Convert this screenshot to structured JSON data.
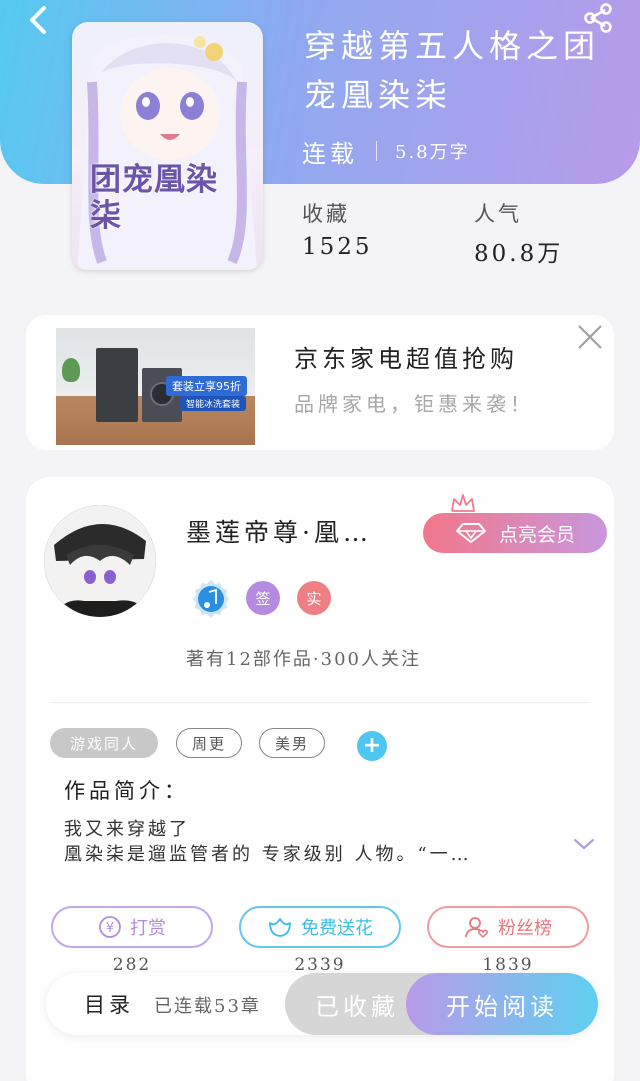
{
  "colors": {
    "hero_start": "#55c9f0",
    "hero_end": "#b79be9",
    "accent_blue": "#4fc6ef",
    "vip_pink": "#f2778a",
    "reward_purple": "#b48be0",
    "flower_blue": "#3cbde8",
    "fans_red": "#e7767d"
  },
  "header": {
    "back_icon": "chevron-left-icon",
    "share_icon": "share-icon"
  },
  "book": {
    "title": "穿越第五人格之团宠凰染柒",
    "status": "连载",
    "word_count": "5.8万字",
    "cover_text": "团宠凰染柒",
    "stats": [
      {
        "label": "收藏",
        "value": "1525"
      },
      {
        "label": "人气",
        "value": "80.8万"
      }
    ]
  },
  "ad": {
    "title": "京东家电超值抢购",
    "subtitle": "品牌家电，钜惠来袭！",
    "banner_text": "套装立享95折",
    "banner_sub": "智能冰洗套装"
  },
  "author": {
    "name": "墨莲帝尊·凰…",
    "vip_label": "点亮会员",
    "badges": [
      "签",
      "实"
    ],
    "stats": "著有12部作品·300人关注"
  },
  "tags": [
    "游戏同人",
    "周更",
    "美男"
  ],
  "intro": {
    "title": "作品简介：",
    "line1": "我又来穿越了",
    "line2": "凰染柒是遛监管者的 专家级别 人物。“一…"
  },
  "actions": [
    {
      "label": "打赏",
      "count": "282",
      "icon": "yuan-coin-icon"
    },
    {
      "label": "免费送花",
      "count": "2339",
      "icon": "flower-icon"
    },
    {
      "label": "粉丝榜",
      "count": "1839",
      "icon": "fan-user-icon"
    }
  ],
  "bottom": {
    "toc_label": "目录",
    "chapters": "已连载53章",
    "collected_label": "已收藏",
    "read_label": "开始阅读"
  }
}
